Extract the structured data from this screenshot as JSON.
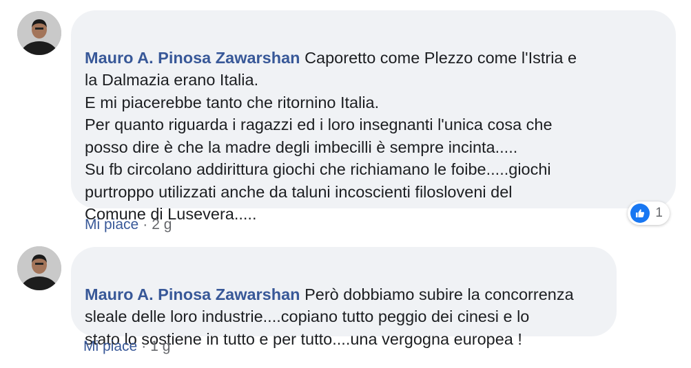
{
  "comments": [
    {
      "author": "Mauro A. Pinosa Zawarshan",
      "text": " Caporetto come Plezzo come l'Istria e\nla Dalmazia erano Italia.\nE mi piacerebbe tanto che ritornino Italia.\nPer quanto riguarda i ragazzi ed i loro insegnanti l'unica cosa che\nposso dire è che la madre degli imbecilli è sempre incinta.....\nSu fb circolano addirittura giochi che richiamano le foibe.....giochi\npurtroppo utilizzati anche da taluni incoscienti filosloveni del\nComune di Lusevera.....",
      "like_label": "Mi piace",
      "separator": "·",
      "time": "2 g",
      "reaction_count": "1"
    },
    {
      "author": "Mauro A. Pinosa Zawarshan",
      "text": " Però dobbiamo subire la concorrenza\nsleale delle loro industrie....copiano tutto peggio dei cinesi e lo\nstato lo sostiene in tutto e per tutto....una vergogna europea !",
      "like_label": "Mi piace",
      "separator": "·",
      "time": "1 g"
    }
  ],
  "colors": {
    "author": "#385898",
    "bubble": "#f0f2f5",
    "meta": "#65676b",
    "like_badge": "#1877f2"
  },
  "icons": {
    "avatar": "profile-photo",
    "reaction": "thumbs-up-icon"
  }
}
